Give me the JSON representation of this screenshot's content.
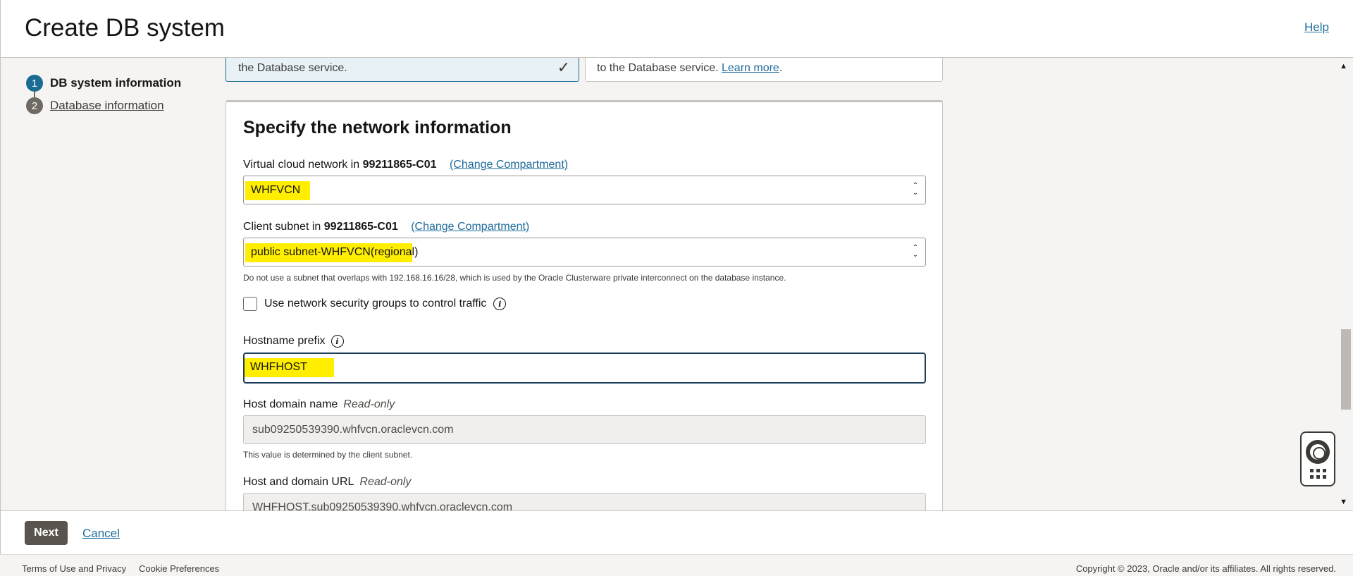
{
  "header": {
    "title": "Create DB system",
    "help_label": "Help"
  },
  "steps": [
    {
      "number": "1",
      "label": "DB system information"
    },
    {
      "number": "2",
      "label": "Database information"
    }
  ],
  "top_cards": {
    "left_text": "the Database service.",
    "right_text": "to the Database service.",
    "right_link": "Learn more",
    "right_suffix": "."
  },
  "network": {
    "title": "Specify the network information",
    "vcn": {
      "label": "Virtual cloud network in",
      "compartment": "99211865-C01",
      "change_link": "(Change Compartment)",
      "value": "WHFVCN"
    },
    "subnet": {
      "label": "Client subnet in",
      "compartment": "99211865-C01",
      "change_link": "(Change Compartment)",
      "value_highlighted": "public subnet-WHFVCN(regiona",
      "value_rest": "l)",
      "hint": "Do not use a subnet that overlaps with 192.168.16.16/28, which is used by the Oracle Clusterware private interconnect on the database instance."
    },
    "nsg_checkbox_label": "Use network security groups to control traffic",
    "hostname": {
      "label": "Hostname prefix",
      "value": "WHFHOST"
    },
    "host_domain": {
      "label": "Host domain name",
      "readonly": "Read-only",
      "value": "sub09250539390.whfvcn.oraclevcn.com",
      "hint": "This value is determined by the client subnet."
    },
    "host_url": {
      "label": "Host and domain URL",
      "readonly": "Read-only",
      "value": "WHFHOST.sub09250539390.whfvcn.oraclevcn.com"
    }
  },
  "actions": {
    "next_label": "Next",
    "cancel_label": "Cancel"
  },
  "footer": {
    "terms": "Terms of Use and Privacy",
    "cookies": "Cookie Preferences",
    "copyright": "Copyright © 2023, Oracle and/or its affiliates. All rights reserved."
  },
  "colors": {
    "highlight": "#ffee00",
    "link": "#1f6c9c",
    "step_active": "#1b6b93"
  }
}
